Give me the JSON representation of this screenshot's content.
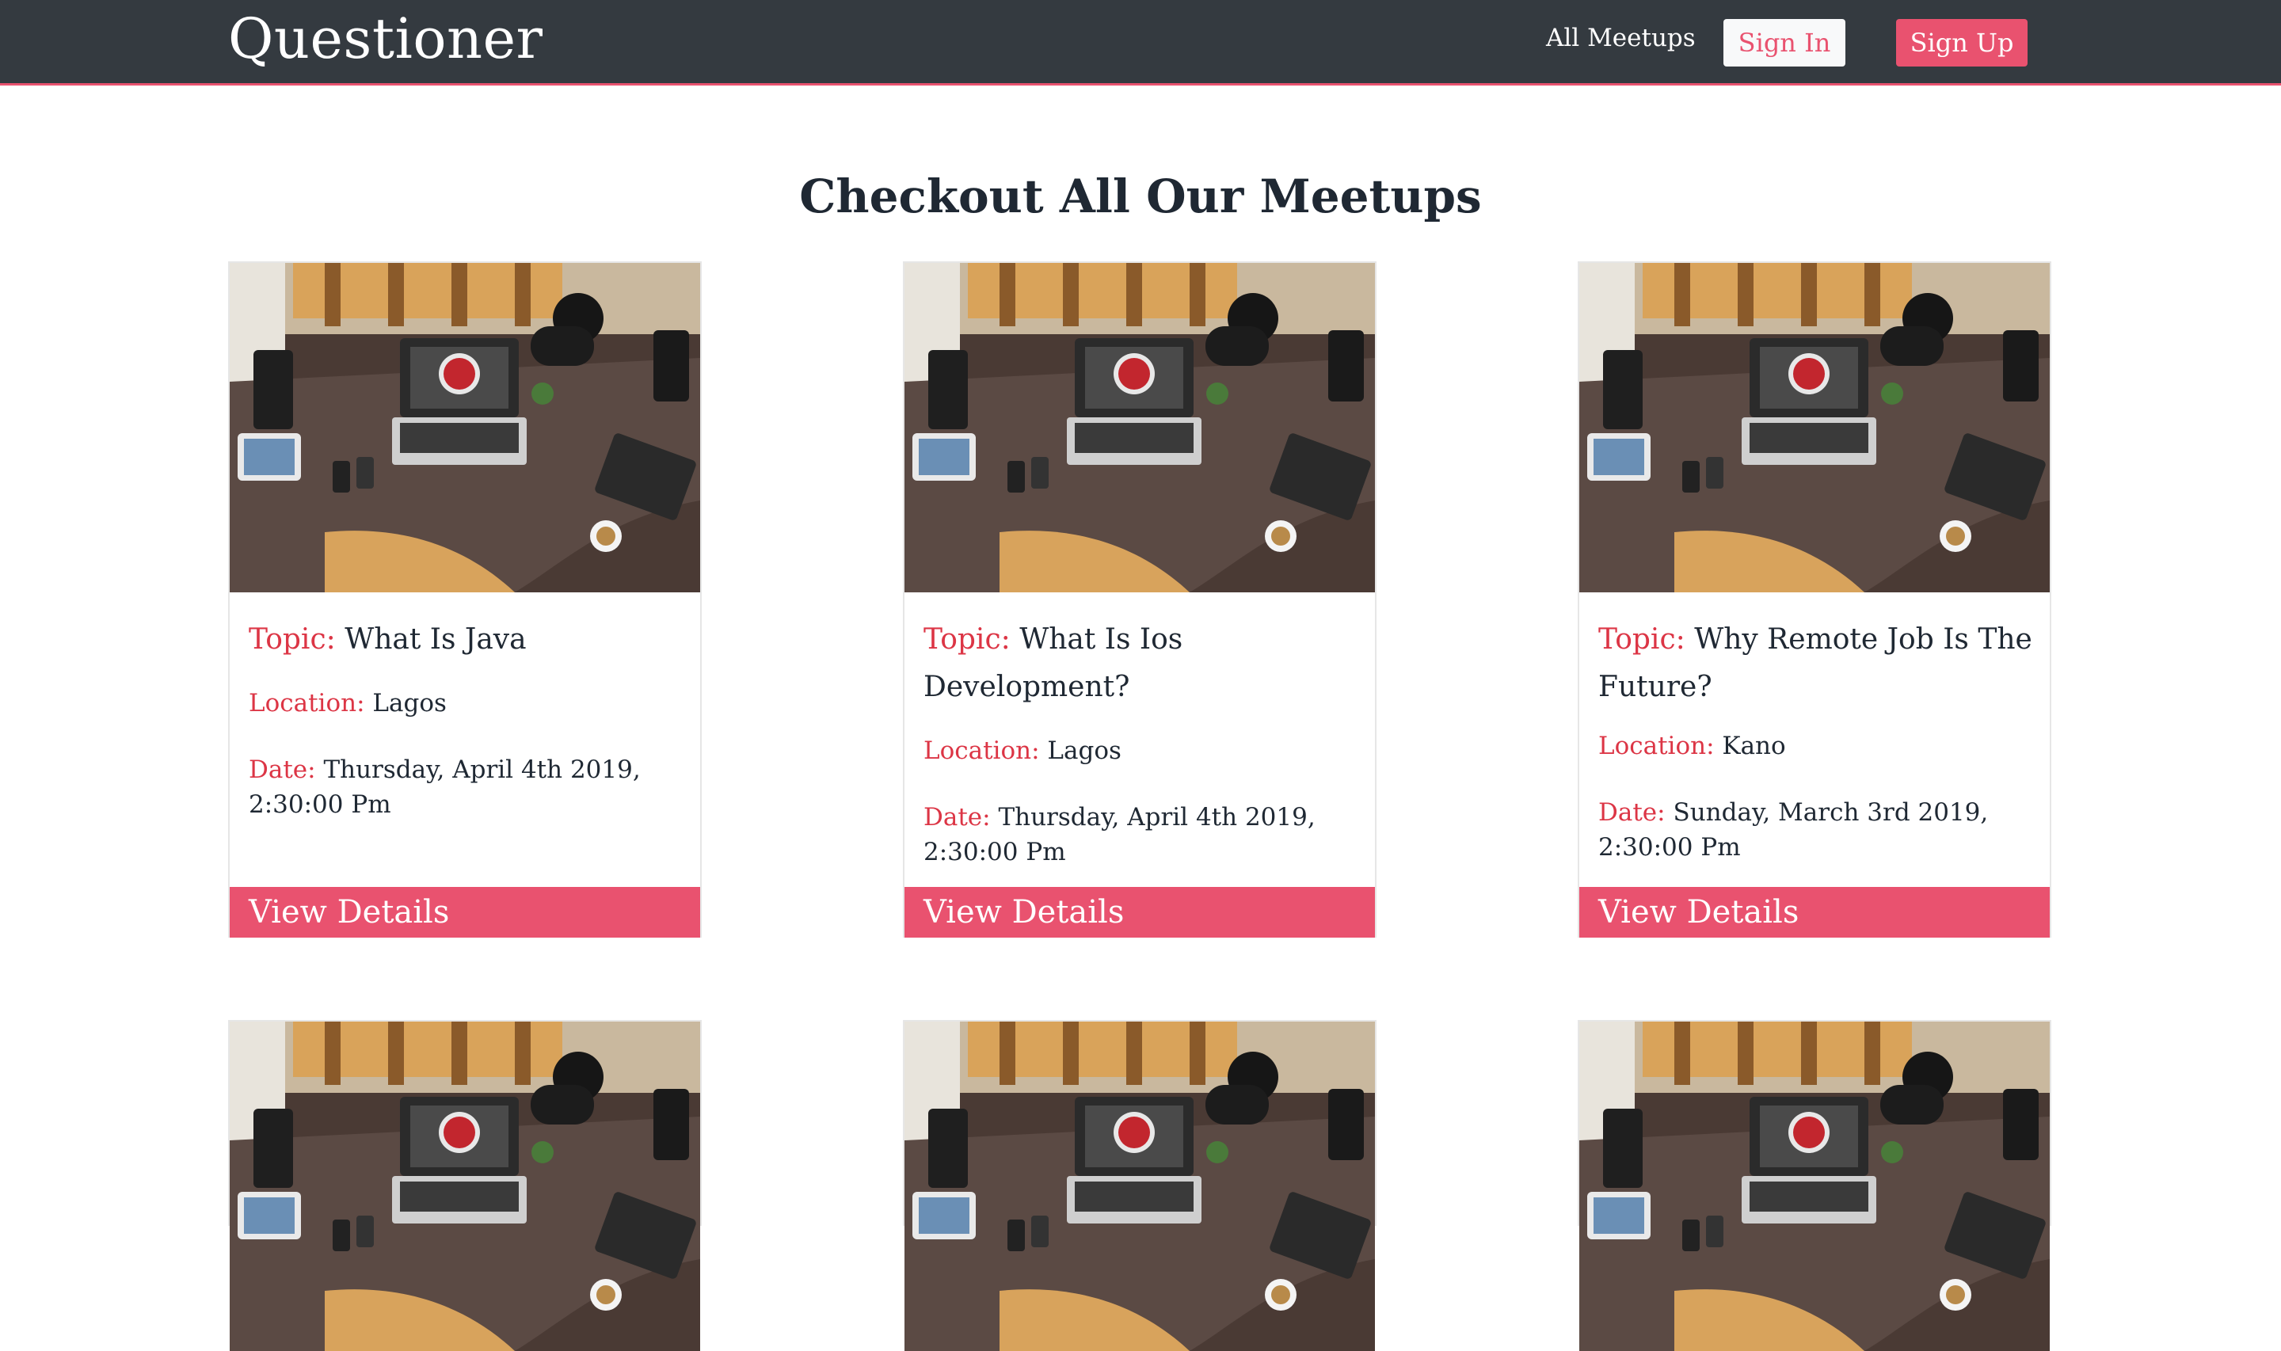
{
  "nav": {
    "brand": "Questioner",
    "all_meetups": "All Meetups",
    "sign_in": "Sign In",
    "sign_up": "Sign Up"
  },
  "page": {
    "heading": "Checkout All Our Meetups"
  },
  "labels": {
    "topic": "Topic:",
    "location": "Location:",
    "date": "Date:",
    "view_details": "View Details"
  },
  "meetups": [
    {
      "topic": "What Is Java",
      "location": "Lagos",
      "date": "Thursday, April 4th 2019, 2:30:00 Pm"
    },
    {
      "topic": "What Is Ios Development?",
      "location": "Lagos",
      "date": "Thursday, April 4th 2019, 2:30:00 Pm"
    },
    {
      "topic": "Why Remote Job Is The Future?",
      "location": "Kano",
      "date": "Sunday, March 3rd 2019, 2:30:00 Pm"
    }
  ],
  "colors": {
    "navbar": "#343a40",
    "accent": "#e9526f",
    "label": "#dc3545"
  }
}
